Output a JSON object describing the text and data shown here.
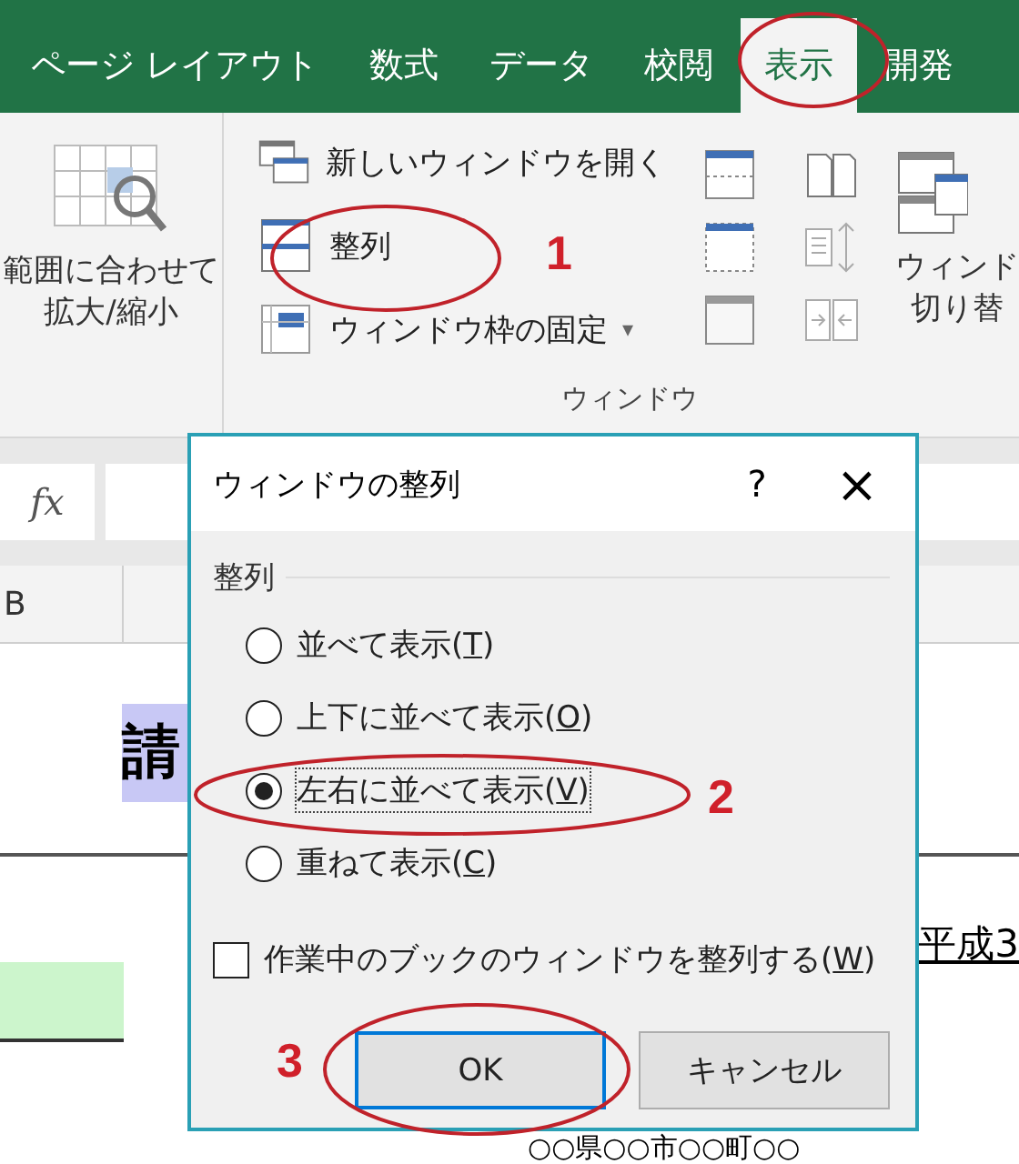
{
  "ribbon_tabs": [
    {
      "label": "ページ レイアウト",
      "selected": false
    },
    {
      "label": "数式",
      "selected": false
    },
    {
      "label": "データ",
      "selected": false
    },
    {
      "label": "校閲",
      "selected": false
    },
    {
      "label": "表示",
      "selected": true
    },
    {
      "label": "開発",
      "selected": false
    }
  ],
  "ribbon": {
    "zoom_label_lines": [
      "範囲に合わせて",
      "拡大/縮小"
    ],
    "window_group": {
      "commands": [
        {
          "label": "新しいウィンドウを開く",
          "dropdown": false
        },
        {
          "label": "整列",
          "dropdown": false
        },
        {
          "label": "ウィンドウ枠の固定",
          "dropdown": true
        }
      ],
      "label": "ウィンドウ",
      "dropdown_glyph": "▾"
    },
    "switch_label_lines": [
      "ウィンド",
      "切り替"
    ]
  },
  "formula_bar": {
    "fx": "fx"
  },
  "column_headers": [
    "B"
  ],
  "sheet": {
    "title_cell": "請",
    "date_text": "平成3",
    "address": "○○県○○市○○町○○"
  },
  "dialog": {
    "title": "ウィンドウの整列",
    "help": "?",
    "close": "×",
    "group_label": "整列",
    "options": [
      {
        "prefix": "並べて表示(",
        "key": "T",
        "suffix": ")",
        "selected": false
      },
      {
        "prefix": "上下に並べて表示(",
        "key": "O",
        "suffix": ")",
        "selected": false
      },
      {
        "prefix": "左右に並べて表示(",
        "key": "V",
        "suffix": ")",
        "selected": true
      },
      {
        "prefix": "重ねて表示(",
        "key": "C",
        "suffix": ")",
        "selected": false
      }
    ],
    "checkbox": {
      "prefix": "作業中のブックのウィンドウを整列する(",
      "key": "W",
      "suffix": ")",
      "checked": false
    },
    "buttons": [
      {
        "label": "OK",
        "default": true
      },
      {
        "label": "キャンセル",
        "default": false
      }
    ]
  },
  "annotations": [
    "1",
    "2",
    "3"
  ]
}
